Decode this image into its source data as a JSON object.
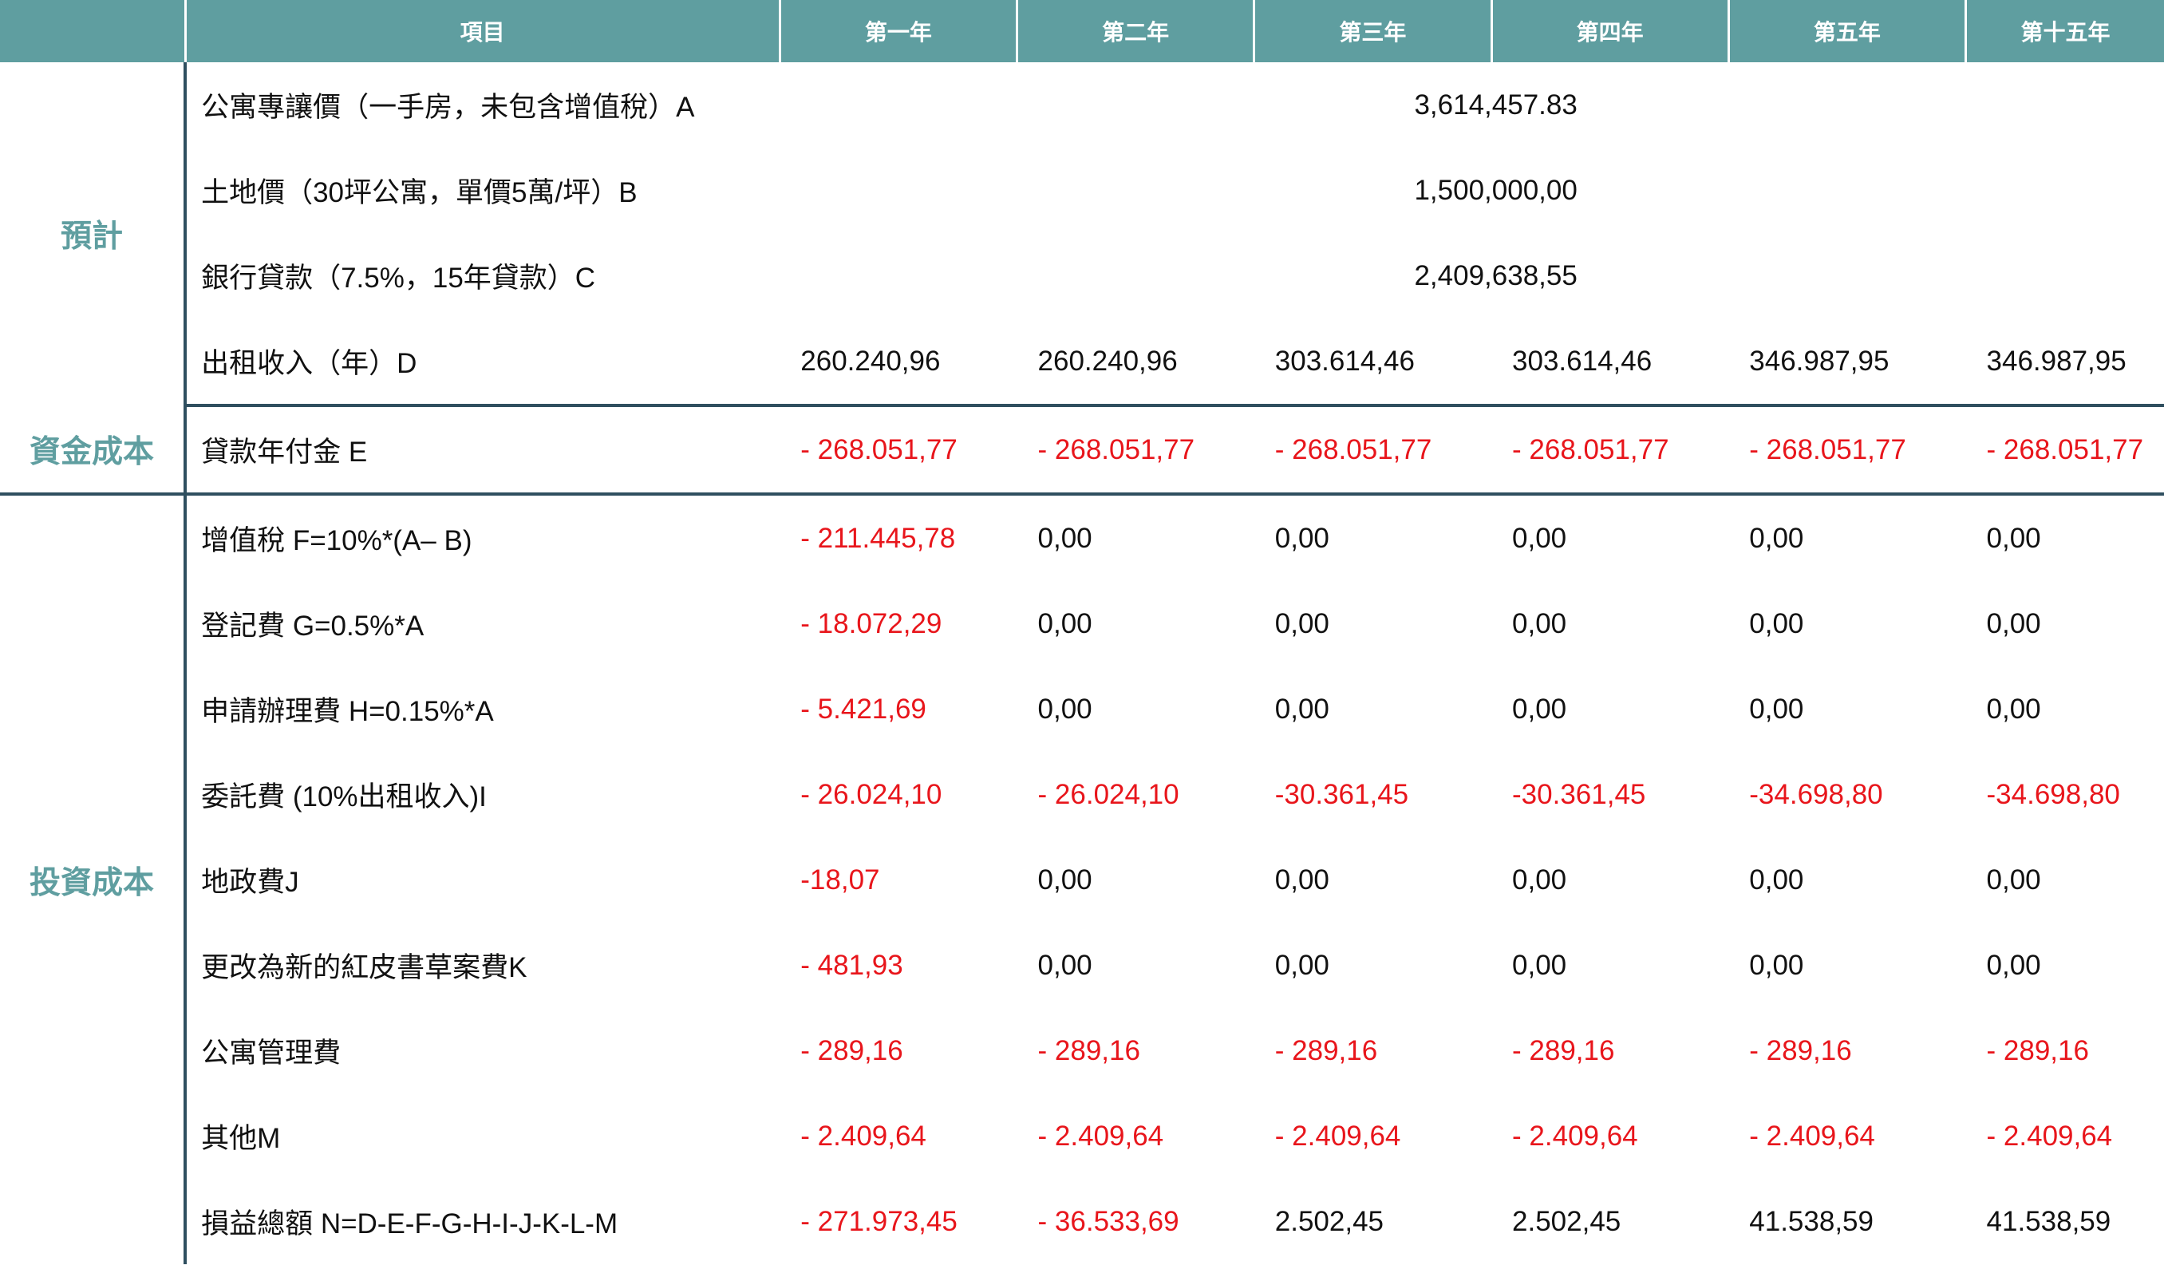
{
  "header": {
    "item": "項目",
    "years": [
      "第一年",
      "第二年",
      "第三年",
      "第四年",
      "第五年",
      "第十五年"
    ]
  },
  "groups": {
    "forecast": "預計",
    "capital_cost": "資金成本",
    "investment_cost": "投資成本"
  },
  "forecast_rows": [
    {
      "label": "公寓專讓價（一手房，未包含增值稅）A",
      "value": "3,614,457.83"
    },
    {
      "label": "土地價（30坪公寓，單價5萬/坪）B",
      "value": "1,500,000,00"
    },
    {
      "label": "銀行貸款（7.5%，15年貸款）C",
      "value": "2,409,638,55"
    }
  ],
  "rental_row": {
    "label": "出租收入（年）D",
    "values": [
      "260.240,96",
      "260.240,96",
      "303.614,46",
      "303.614,46",
      "346.987,95",
      "346.987,95"
    ]
  },
  "capital_row": {
    "label": "貸款年付金 E",
    "values": [
      "- 268.051,77",
      "- 268.051,77",
      "- 268.051,77",
      "- 268.051,77",
      "- 268.051,77",
      "- 268.051,77"
    ]
  },
  "investment_rows": [
    {
      "label": "增值稅 F=10%*(A– B)",
      "values": [
        "- 211.445,78",
        "0,00",
        "0,00",
        "0,00",
        "0,00",
        "0,00"
      ]
    },
    {
      "label": "登記費 G=0.5%*A",
      "values": [
        "- 18.072,29",
        "0,00",
        "0,00",
        "0,00",
        "0,00",
        "0,00"
      ]
    },
    {
      "label": "申請辦理費 H=0.15%*A",
      "values": [
        "- 5.421,69",
        "0,00",
        "0,00",
        "0,00",
        "0,00",
        "0,00"
      ]
    },
    {
      "label": "委託費 (10%出租收入)I",
      "values": [
        "- 26.024,10",
        "- 26.024,10",
        "-30.361,45",
        "-30.361,45",
        "-34.698,80",
        "-34.698,80"
      ]
    },
    {
      "label": "地政費J",
      "values": [
        "-18,07",
        "0,00",
        "0,00",
        "0,00",
        "0,00",
        "0,00"
      ]
    },
    {
      "label": "更改為新的紅皮書草案費K",
      "values": [
        "- 481,93",
        "0,00",
        "0,00",
        "0,00",
        "0,00",
        "0,00"
      ]
    },
    {
      "label": "公寓管理費",
      "values": [
        "- 289,16",
        "- 289,16",
        "- 289,16",
        "- 289,16",
        "- 289,16",
        "- 289,16"
      ]
    },
    {
      "label": "其他M",
      "values": [
        "- 2.409,64",
        "- 2.409,64",
        "- 2.409,64",
        "- 2.409,64",
        "- 2.409,64",
        "- 2.409,64"
      ]
    },
    {
      "label": "損益總額 N=D-E-F-G-H-I-J-K-L-M",
      "values": [
        "- 271.973,45",
        "- 36.533,69",
        "2.502,45",
        "2.502,45",
        "41.538,59",
        "41.538,59"
      ]
    }
  ],
  "colors": {
    "header_bg": "#5f9ea0",
    "group_text": "#5f9ea0",
    "negative": "#e8151b",
    "rule": "#2f4f5f"
  }
}
